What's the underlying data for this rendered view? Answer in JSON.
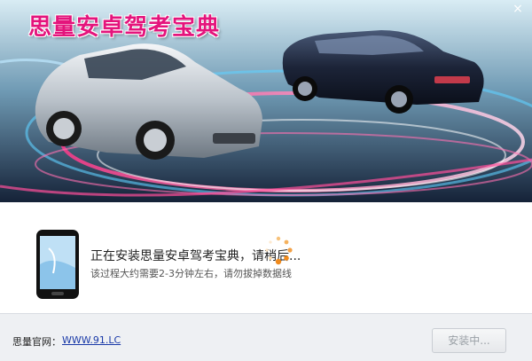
{
  "banner": {
    "title": "思量安卓驾考宝典",
    "close_glyph": "×"
  },
  "install": {
    "title": "正在安装思量安卓驾考宝典，请稍后...",
    "subtitle": "该过程大约需要2-3分钟左右，请勿拔掉数据线"
  },
  "footer": {
    "site_label": "思量官网：",
    "site_url": "WWW.91.LC",
    "install_button": "安装中..."
  },
  "colors": {
    "title_accent": "#e4147c",
    "link": "#1a3aa8",
    "spinner": "#f08a1c"
  }
}
